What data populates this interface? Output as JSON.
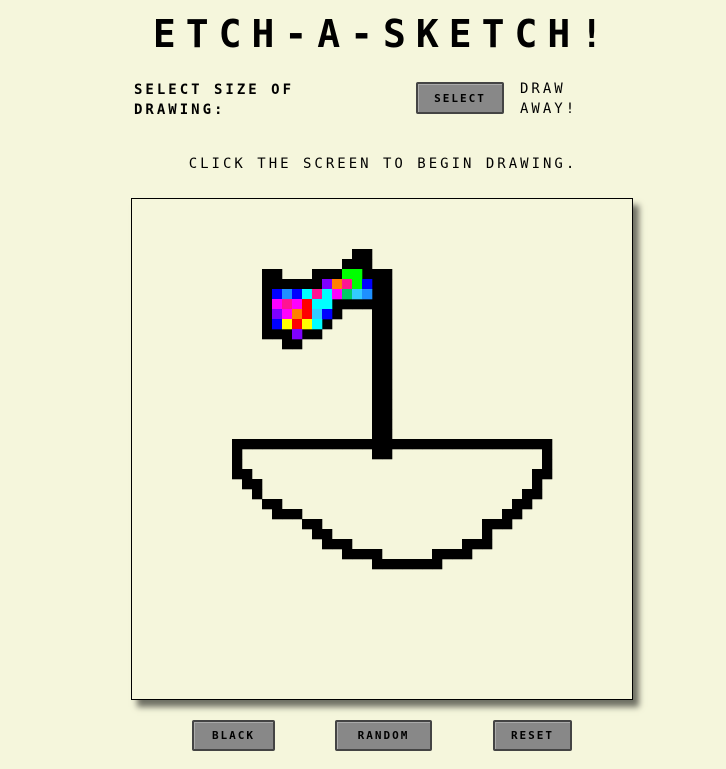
{
  "header": {
    "title": "ETCH-A-SKETCH!"
  },
  "controls": {
    "size_label": "SELECT SIZE OF DRAWING:",
    "select_button": "SELECT",
    "draw_away": "DRAW AWAY!"
  },
  "instructions": "CLICK THE SCREEN TO BEGIN DRAWING.",
  "buttons": {
    "black": "BLACK",
    "random": "RANDOM",
    "reset": "RESET"
  },
  "sketch": {
    "grid_columns": 50,
    "background_color": "#f5f6dc",
    "ink_color": "#000000",
    "palette": [
      "#ff0000",
      "#00ff00",
      "#0000ff",
      "#ff00ff",
      "#00ffff",
      "#ffff00",
      "#ff7f00",
      "#7f00ff",
      "#1e90ff",
      "#ff1493",
      "#00cc66",
      "#33ccff"
    ],
    "black_cells": [
      [
        22,
        5
      ],
      [
        23,
        5
      ],
      [
        21,
        6
      ],
      [
        22,
        6
      ],
      [
        23,
        6
      ],
      [
        13,
        7
      ],
      [
        14,
        7
      ],
      [
        18,
        7
      ],
      [
        19,
        7
      ],
      [
        20,
        7
      ],
      [
        23,
        7
      ],
      [
        24,
        7
      ],
      [
        25,
        7
      ],
      [
        13,
        8
      ],
      [
        14,
        8
      ],
      [
        15,
        8
      ],
      [
        16,
        8
      ],
      [
        17,
        8
      ],
      [
        18,
        8
      ],
      [
        24,
        8
      ],
      [
        25,
        8
      ],
      [
        13,
        9
      ],
      [
        24,
        9
      ],
      [
        25,
        9
      ],
      [
        13,
        10
      ],
      [
        20,
        10
      ],
      [
        21,
        10
      ],
      [
        22,
        10
      ],
      [
        23,
        10
      ],
      [
        24,
        10
      ],
      [
        25,
        10
      ],
      [
        13,
        11
      ],
      [
        20,
        11
      ],
      [
        24,
        11
      ],
      [
        25,
        11
      ],
      [
        13,
        12
      ],
      [
        19,
        12
      ],
      [
        24,
        12
      ],
      [
        25,
        12
      ],
      [
        13,
        13
      ],
      [
        14,
        13
      ],
      [
        15,
        13
      ],
      [
        16,
        13
      ],
      [
        17,
        13
      ],
      [
        18,
        13
      ],
      [
        24,
        13
      ],
      [
        25,
        13
      ],
      [
        15,
        14
      ],
      [
        16,
        14
      ],
      [
        24,
        14
      ],
      [
        25,
        14
      ],
      [
        24,
        15
      ],
      [
        25,
        15
      ],
      [
        24,
        16
      ],
      [
        25,
        16
      ],
      [
        24,
        17
      ],
      [
        25,
        17
      ],
      [
        24,
        18
      ],
      [
        25,
        18
      ],
      [
        24,
        19
      ],
      [
        25,
        19
      ],
      [
        24,
        20
      ],
      [
        25,
        20
      ],
      [
        24,
        21
      ],
      [
        25,
        21
      ],
      [
        24,
        22
      ],
      [
        25,
        22
      ],
      [
        24,
        23
      ],
      [
        25,
        23
      ],
      [
        10,
        24
      ],
      [
        11,
        24
      ],
      [
        12,
        24
      ],
      [
        13,
        24
      ],
      [
        14,
        24
      ],
      [
        15,
        24
      ],
      [
        16,
        24
      ],
      [
        17,
        24
      ],
      [
        18,
        24
      ],
      [
        19,
        24
      ],
      [
        20,
        24
      ],
      [
        21,
        24
      ],
      [
        22,
        24
      ],
      [
        23,
        24
      ],
      [
        24,
        24
      ],
      [
        25,
        24
      ],
      [
        26,
        24
      ],
      [
        27,
        24
      ],
      [
        28,
        24
      ],
      [
        29,
        24
      ],
      [
        30,
        24
      ],
      [
        31,
        24
      ],
      [
        32,
        24
      ],
      [
        33,
        24
      ],
      [
        34,
        24
      ],
      [
        35,
        24
      ],
      [
        36,
        24
      ],
      [
        37,
        24
      ],
      [
        38,
        24
      ],
      [
        39,
        24
      ],
      [
        40,
        24
      ],
      [
        41,
        24
      ],
      [
        10,
        25
      ],
      [
        24,
        25
      ],
      [
        25,
        25
      ],
      [
        41,
        25
      ],
      [
        10,
        26
      ],
      [
        41,
        26
      ],
      [
        10,
        27
      ],
      [
        11,
        27
      ],
      [
        40,
        27
      ],
      [
        41,
        27
      ],
      [
        11,
        28
      ],
      [
        12,
        28
      ],
      [
        40,
        28
      ],
      [
        12,
        29
      ],
      [
        39,
        29
      ],
      [
        40,
        29
      ],
      [
        13,
        30
      ],
      [
        14,
        30
      ],
      [
        38,
        30
      ],
      [
        39,
        30
      ],
      [
        14,
        31
      ],
      [
        15,
        31
      ],
      [
        16,
        31
      ],
      [
        37,
        31
      ],
      [
        38,
        31
      ],
      [
        17,
        32
      ],
      [
        18,
        32
      ],
      [
        35,
        32
      ],
      [
        36,
        32
      ],
      [
        37,
        32
      ],
      [
        18,
        33
      ],
      [
        19,
        33
      ],
      [
        35,
        33
      ],
      [
        19,
        34
      ],
      [
        20,
        34
      ],
      [
        21,
        34
      ],
      [
        33,
        34
      ],
      [
        34,
        34
      ],
      [
        35,
        34
      ],
      [
        21,
        35
      ],
      [
        22,
        35
      ],
      [
        23,
        35
      ],
      [
        24,
        35
      ],
      [
        30,
        35
      ],
      [
        31,
        35
      ],
      [
        32,
        35
      ],
      [
        33,
        35
      ],
      [
        24,
        36
      ],
      [
        25,
        36
      ],
      [
        26,
        36
      ],
      [
        27,
        36
      ],
      [
        28,
        36
      ],
      [
        29,
        36
      ],
      [
        30,
        36
      ]
    ],
    "color_cells": [
      [
        22,
        7,
        1
      ],
      [
        21,
        7,
        1
      ],
      [
        19,
        8,
        7
      ],
      [
        20,
        8,
        6
      ],
      [
        21,
        8,
        9
      ],
      [
        22,
        8,
        1
      ],
      [
        23,
        8,
        2
      ],
      [
        14,
        9,
        2
      ],
      [
        15,
        9,
        8
      ],
      [
        16,
        9,
        2
      ],
      [
        17,
        9,
        4
      ],
      [
        18,
        9,
        9
      ],
      [
        19,
        9,
        4
      ],
      [
        20,
        9,
        3
      ],
      [
        21,
        9,
        10
      ],
      [
        22,
        9,
        11
      ],
      [
        23,
        9,
        8
      ],
      [
        14,
        10,
        3
      ],
      [
        15,
        10,
        9
      ],
      [
        16,
        10,
        3
      ],
      [
        17,
        10,
        0
      ],
      [
        18,
        10,
        4
      ],
      [
        19,
        10,
        4
      ],
      [
        14,
        11,
        7
      ],
      [
        15,
        11,
        3
      ],
      [
        16,
        11,
        6
      ],
      [
        17,
        11,
        0
      ],
      [
        18,
        11,
        11
      ],
      [
        19,
        11,
        2
      ],
      [
        14,
        12,
        2
      ],
      [
        15,
        12,
        5
      ],
      [
        16,
        12,
        0
      ],
      [
        17,
        12,
        5
      ],
      [
        18,
        12,
        4
      ],
      [
        16,
        13,
        7
      ]
    ]
  }
}
